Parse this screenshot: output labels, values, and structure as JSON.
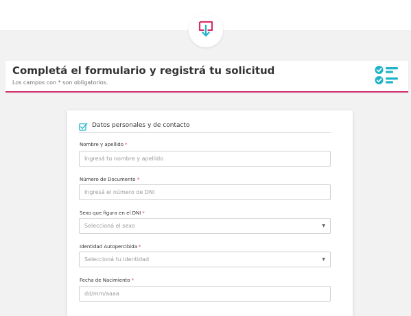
{
  "page": {
    "title": "Completá el formulario y registrá tu solicitud",
    "subtitle": "Los campos con * son obligatorios."
  },
  "icons": {
    "top_logo": "download-tray-icon",
    "header": "checklist-icon",
    "section": "checkbox-icon",
    "select": "chevron-down-icon"
  },
  "colors": {
    "accent_pink": "#d3306d",
    "accent_teal": "#1fb3c9",
    "required_asterisk": "#e0315b"
  },
  "section": {
    "title": "Datos personales y de contacto"
  },
  "fields": [
    {
      "label": "Nombre y apellido",
      "required": "*",
      "placeholder": "Ingresá tu nombre y apellido"
    },
    {
      "label": "Número de Documento",
      "required": "*",
      "placeholder": "Ingresá el número de DNI"
    },
    {
      "label": "Sexo que figura en el DNI",
      "required": "*",
      "value": "Seleccioná el sexo"
    },
    {
      "label": "Identidad Autopercibida",
      "required": "*",
      "value": "Seleccioná tu identidad"
    },
    {
      "label": "Fecha de Nacimiento",
      "required": "*",
      "placeholder": "dd/mm/aaaa"
    }
  ]
}
